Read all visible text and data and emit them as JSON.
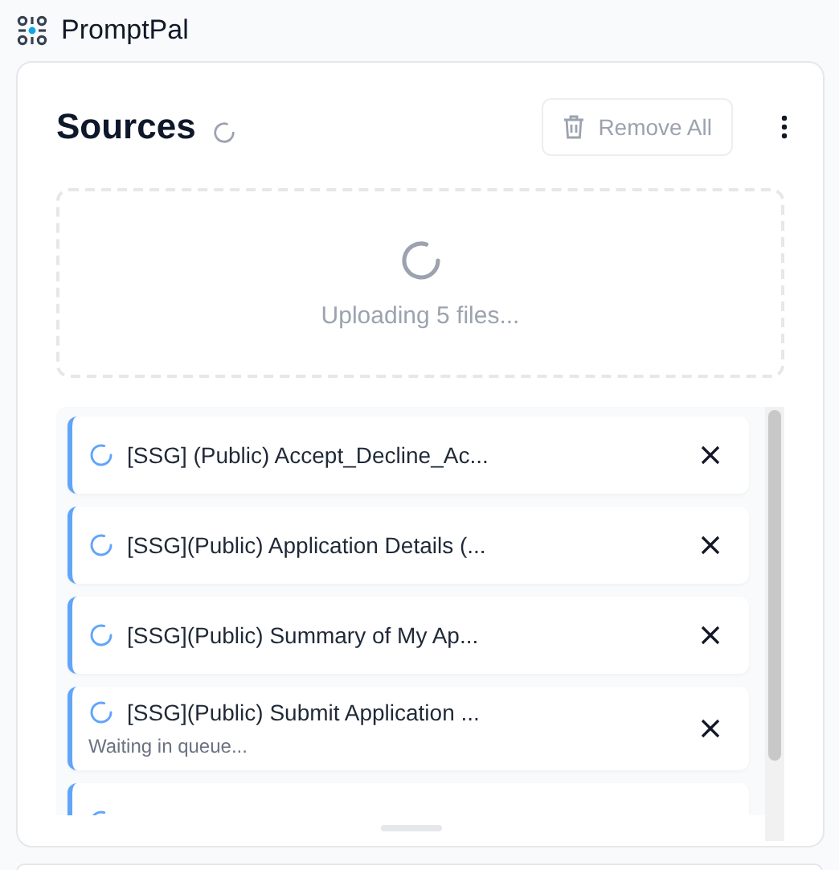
{
  "app": {
    "title": "PromptPal"
  },
  "sources": {
    "title": "Sources",
    "loading": true,
    "remove_all": {
      "label": "Remove All",
      "disabled": true
    },
    "upload": {
      "message": "Uploading 5 files..."
    },
    "files": [
      {
        "kind": "file",
        "name": "[SSG] (Public) Accept_Decline_Ac..."
      },
      {
        "kind": "file",
        "name": "[SSG](Public) Application Details (..."
      },
      {
        "kind": "file",
        "name": "[SSG](Public) Summary of My Ap..."
      },
      {
        "kind": "file",
        "name": "[SSG](Public) Submit Application ...",
        "status": "Waiting in queue..."
      },
      {
        "kind": "cut-off"
      }
    ]
  }
}
